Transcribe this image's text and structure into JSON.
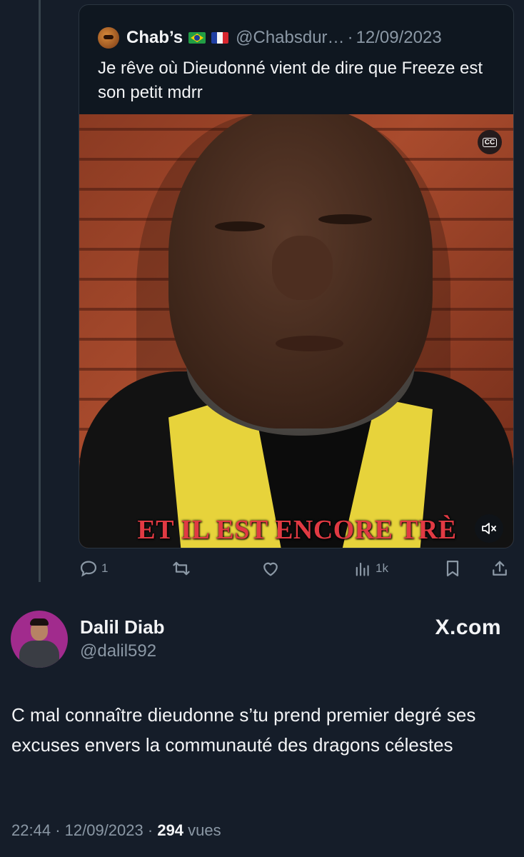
{
  "quoted_tweet": {
    "author_name": "Chab’s",
    "flags": [
      "🇧🇷",
      "🇫🇷"
    ],
    "handle": "@Chabsdur…",
    "separator": "·",
    "date": "12/09/2023",
    "text": "Je rêve où Dieudonné vient de dire que Freeze est son petit mdrr",
    "media": {
      "type": "video",
      "caption_overlay": "ET IL EST ENCORE TRÈ",
      "cc_label": "CC",
      "muted": true
    }
  },
  "actions": {
    "reply_count": "1",
    "retweet_count": "",
    "like_count": "",
    "views_count": "1k"
  },
  "tweet": {
    "author_name": "Dalil Diab",
    "handle": "@dalil592",
    "source_badge": "X.com",
    "text": "C mal connaître dieudonne s’tu prend premier degré ses excuses envers la communauté des dragons célestes",
    "time": "22:44",
    "separator": "·",
    "date": "12/09/2023",
    "views": "294",
    "views_label": "vues"
  },
  "colors": {
    "background": "#151d29",
    "text": "#e7e9ea",
    "secondary_text": "#8b98a5",
    "caption": "#e13a43",
    "avatar_bg": "#a12b8d"
  }
}
